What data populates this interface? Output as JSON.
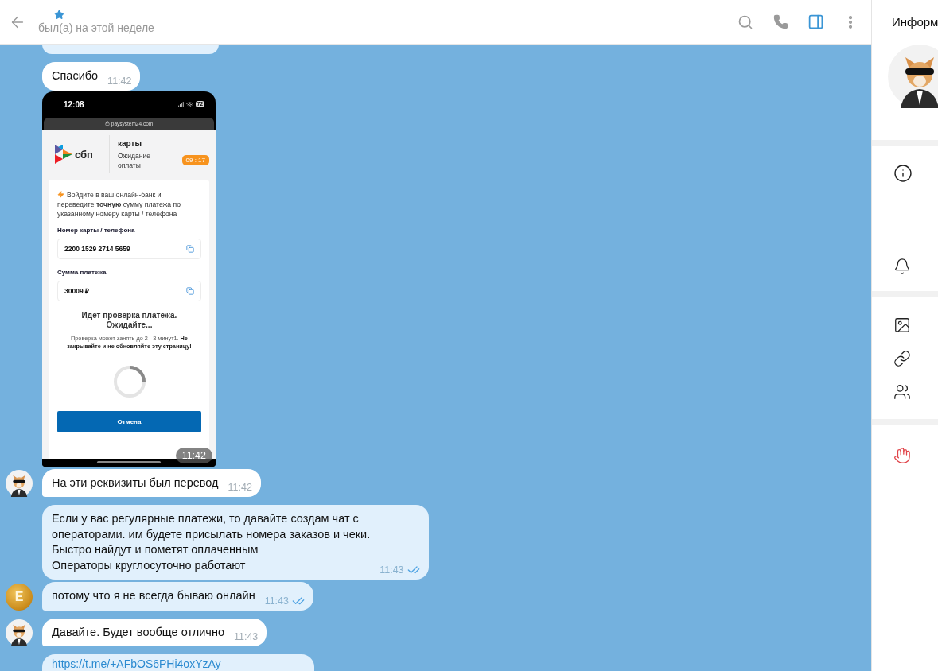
{
  "header": {
    "status": "был(а) на этой неделе",
    "sidebar_open": true
  },
  "messages": [
    {
      "kind": "clipped",
      "outgoing": true
    },
    {
      "kind": "text",
      "outgoing": false,
      "text": "Спасибо",
      "time": "11:42"
    },
    {
      "kind": "screenshot",
      "outgoing": false,
      "time": "11:42",
      "screenshot": {
        "clock": "12:08",
        "battery": "72",
        "url": "paysystem24.com",
        "logo_text": "сбп",
        "title": "карты",
        "status": "Ожидание оплаты",
        "timer": "09 : 17",
        "instruction": "Войдите в ваш онлайн-банк и переведите **точную** сумму платежа по указанному номеру карты / телефона",
        "fields": [
          {
            "label": "Номер карты / телефона",
            "value": "2200 1529 2714 5659"
          },
          {
            "label": "Сумма платежа",
            "value": "30009 ₽"
          }
        ],
        "check_title": "Идет проверка платежа. Ожидайте...",
        "check_note": "Проверка может занять до 2 - 3 минут1. **Не закрывайте и не обновляйте эту страницу!**",
        "button": "Отмена"
      }
    },
    {
      "kind": "text",
      "outgoing": false,
      "avatar": {
        "kind": "dog"
      },
      "text": "На эти реквизиты был перевод",
      "time": "11:42"
    },
    {
      "kind": "text",
      "outgoing": true,
      "read": true,
      "text": "Если у вас регулярные платежи, то давайте создам чат с\nоператорами. им будете присылать номера заказов и чеки.\nБыстро найдут и пометят оплаченным\nОператоры круглосуточно работают",
      "time": "11:43"
    },
    {
      "kind": "text",
      "outgoing": true,
      "read": true,
      "avatar": {
        "kind": "coin",
        "letter": "E"
      },
      "text": "потому что я не всегда бываю онлайн",
      "time": "11:43"
    },
    {
      "kind": "text",
      "outgoing": false,
      "avatar": {
        "kind": "dog"
      },
      "text": "Давайте. Будет вообще отлично",
      "time": "11:43"
    },
    {
      "kind": "link",
      "outgoing": true,
      "text": "https://t.me/+AFbOS6PHi4oxYzAy"
    }
  ],
  "info_panel": {
    "title": "Информ"
  }
}
